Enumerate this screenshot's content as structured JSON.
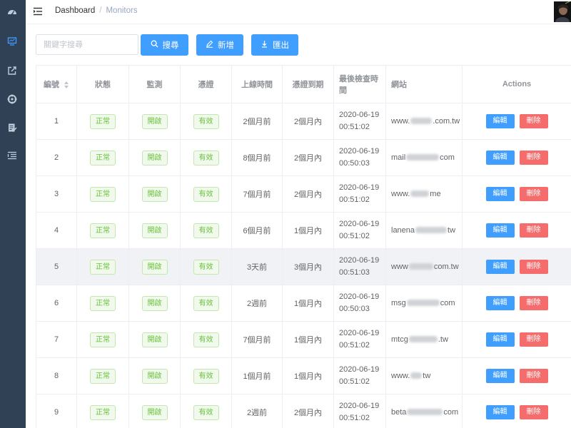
{
  "sidebar": {
    "items": [
      {
        "icon": "dashboard-icon",
        "active": false
      },
      {
        "icon": "monitor-icon",
        "active": true
      },
      {
        "icon": "external-link-icon",
        "active": false
      },
      {
        "icon": "target-icon",
        "active": false
      },
      {
        "icon": "form-icon",
        "active": false
      },
      {
        "icon": "list-icon",
        "active": false
      }
    ]
  },
  "breadcrumb": {
    "home": "Dashboard",
    "separator": "/",
    "current": "Monitors"
  },
  "toolbar": {
    "search_placeholder": "關鍵字搜尋",
    "search_label": "搜尋",
    "add_label": "新增",
    "export_label": "匯出"
  },
  "table": {
    "columns": [
      "編號",
      "狀態",
      "監測",
      "憑證",
      "上線時間",
      "憑證到期",
      "最後檢查時間",
      "網站",
      "Actions"
    ],
    "edit_label": "編輯",
    "delete_label": "刪除",
    "rows": [
      {
        "id": "1",
        "status": "正常",
        "monitor": "開啟",
        "cert": "有效",
        "uptime": "2個月前",
        "expiry": "2個月內",
        "date": "2020-06-19",
        "time": "00:51:02",
        "site_a": "www.",
        "site_b": ".com.tw"
      },
      {
        "id": "2",
        "status": "正常",
        "monitor": "開啟",
        "cert": "有效",
        "uptime": "8個月前",
        "expiry": "2個月內",
        "date": "2020-06-19",
        "time": "00:50:03",
        "site_a": "mail",
        "site_b": "com"
      },
      {
        "id": "3",
        "status": "正常",
        "monitor": "開啟",
        "cert": "有效",
        "uptime": "7個月前",
        "expiry": "2個月內",
        "date": "2020-06-19",
        "time": "00:51:02",
        "site_a": "www.",
        "site_b": "me"
      },
      {
        "id": "4",
        "status": "正常",
        "monitor": "開啟",
        "cert": "有效",
        "uptime": "6個月前",
        "expiry": "1個月內",
        "date": "2020-06-19",
        "time": "00:51:02",
        "site_a": "lanena",
        "site_b": "tw"
      },
      {
        "id": "5",
        "status": "正常",
        "monitor": "開啟",
        "cert": "有效",
        "uptime": "3天前",
        "expiry": "3個月內",
        "date": "2020-06-19",
        "time": "00:51:03",
        "site_a": "www",
        "site_b": "com.tw"
      },
      {
        "id": "6",
        "status": "正常",
        "monitor": "開啟",
        "cert": "有效",
        "uptime": "2週前",
        "expiry": "1個月內",
        "date": "2020-06-19",
        "time": "00:50:03",
        "site_a": "msg",
        "site_b": "com"
      },
      {
        "id": "7",
        "status": "正常",
        "monitor": "開啟",
        "cert": "有效",
        "uptime": "7個月前",
        "expiry": "1個月內",
        "date": "2020-06-19",
        "time": "00:51:02",
        "site_a": "mtcg",
        "site_b": ".tw"
      },
      {
        "id": "8",
        "status": "正常",
        "monitor": "開啟",
        "cert": "有效",
        "uptime": "1個月前",
        "expiry": "1個月內",
        "date": "2020-06-19",
        "time": "00:51:02",
        "site_a": "www.",
        "site_b": "tw"
      },
      {
        "id": "9",
        "status": "正常",
        "monitor": "開啟",
        "cert": "有效",
        "uptime": "2週前",
        "expiry": "2個月內",
        "date": "2020-06-19",
        "time": "00:51:02",
        "site_a": "beta",
        "site_b": "com"
      }
    ]
  },
  "colors": {
    "sidebar_bg": "#304156",
    "primary": "#409eff",
    "danger": "#f56c6c",
    "success": "#67c23a",
    "active_icon": "#409eff",
    "icon": "#bfcbd9"
  }
}
